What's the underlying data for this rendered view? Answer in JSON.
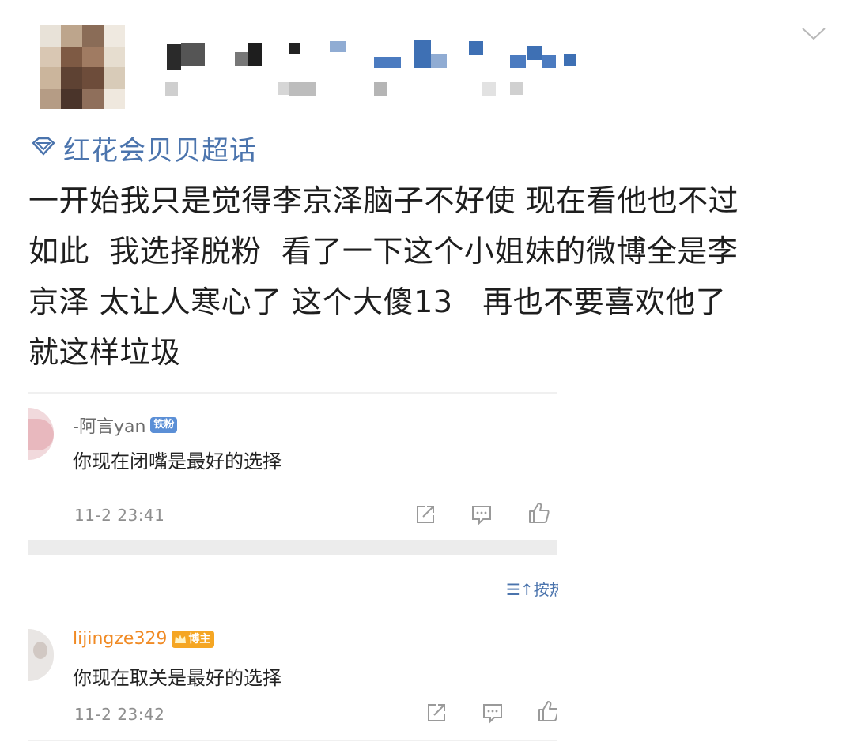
{
  "post": {
    "supertopic": "红花会贝贝超话",
    "body": "一开始我只是觉得李京泽脑子不好使 现在看他也不过\n如此  我选择脱粉  看了一下这个小姐妹的微博全是李\n京泽 太让人寒心了 这个大傻13   再也不要喜欢他了\n就这样垃圾"
  },
  "icons": {
    "menu": "chevron-down-icon",
    "topic": "diamond-icon",
    "share": "share-icon",
    "comment": "comment-icon",
    "like": "like-icon",
    "sort": "sort-icon"
  },
  "sort": {
    "label": "按热"
  },
  "comments": [
    {
      "username": "-阿言yan",
      "badge": "铁粉",
      "text": "你现在闭嘴是最好的选择",
      "time": "11-2 23:41"
    },
    {
      "username": "lijingze329",
      "badge": "博主",
      "text": "你现在取关是最好的选择",
      "time": "11-2 23:42"
    }
  ],
  "colors": {
    "accent_blue": "#4b74ad",
    "fan_badge": "#5b8fd6",
    "owner_badge": "#f5a623",
    "meta_gray": "#8e8e8e"
  }
}
